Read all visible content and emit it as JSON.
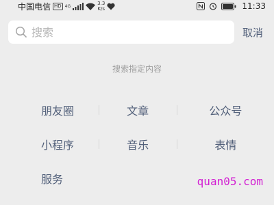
{
  "status_bar": {
    "carrier": "中国电信",
    "hd_badge": "HD",
    "network_type": "4G",
    "speed_value": "3.3",
    "speed_unit": "K/s",
    "battery_icon": "battery-icon",
    "time": "11:33"
  },
  "search": {
    "placeholder": "搜索",
    "value": "",
    "cancel_label": "取消"
  },
  "hint": "搜索指定内容",
  "categories": {
    "row1": [
      "朋友圈",
      "文章",
      "公众号"
    ],
    "row2": [
      "小程序",
      "音乐",
      "表情"
    ],
    "row3": [
      "服务"
    ]
  },
  "watermark": "quan05.com",
  "colors": {
    "background": "#ededed",
    "category_text": "#52607a",
    "hint_text": "#9c9c9c",
    "watermark": "#d21ed2"
  }
}
